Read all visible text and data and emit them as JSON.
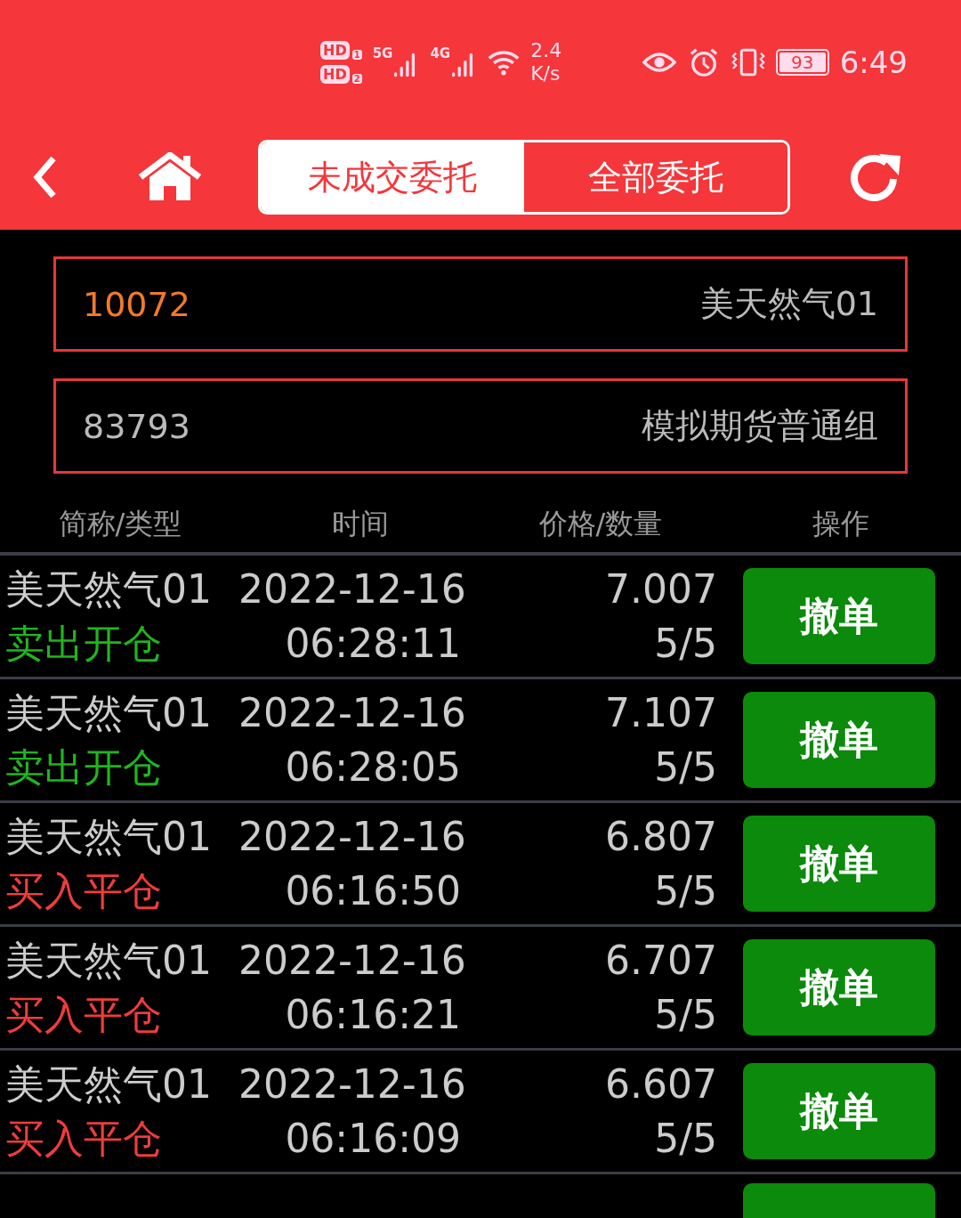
{
  "status_bar": {
    "sims": [
      {
        "label": "HD",
        "slot": "1"
      },
      {
        "label": "HD",
        "slot": "2"
      }
    ],
    "networks": [
      "5G",
      "4G"
    ],
    "speed_value": "2.4",
    "speed_unit": "K/s",
    "battery": "93",
    "time": "6:49"
  },
  "tabs": [
    {
      "label": "未成交委托",
      "selected": true
    },
    {
      "label": "全部委托",
      "selected": false
    }
  ],
  "contract_field": {
    "code": "10072",
    "name": "美天然气01"
  },
  "account_field": {
    "code": "83793",
    "name": "模拟期货普通组"
  },
  "table": {
    "columns": [
      "简称/类型",
      "时间",
      "价格/数量",
      "操作"
    ],
    "rows": [
      {
        "name": "美天然气01",
        "type": "卖出开仓",
        "kind": "sell",
        "date": "2022-12-16",
        "time": "06:28:11",
        "price": "7.007",
        "quantity": "5/5",
        "action": "撤单"
      },
      {
        "name": "美天然气01",
        "type": "卖出开仓",
        "kind": "sell",
        "date": "2022-12-16",
        "time": "06:28:05",
        "price": "7.107",
        "quantity": "5/5",
        "action": "撤单"
      },
      {
        "name": "美天然气01",
        "type": "买入平仓",
        "kind": "buy",
        "date": "2022-12-16",
        "time": "06:16:50",
        "price": "6.807",
        "quantity": "5/5",
        "action": "撤单"
      },
      {
        "name": "美天然气01",
        "type": "买入平仓",
        "kind": "buy",
        "date": "2022-12-16",
        "time": "06:16:21",
        "price": "6.707",
        "quantity": "5/5",
        "action": "撤单"
      },
      {
        "name": "美天然气01",
        "type": "买入平仓",
        "kind": "buy",
        "date": "2022-12-16",
        "time": "06:16:09",
        "price": "6.607",
        "quantity": "5/5",
        "action": "撤单"
      }
    ],
    "has_more": true
  }
}
